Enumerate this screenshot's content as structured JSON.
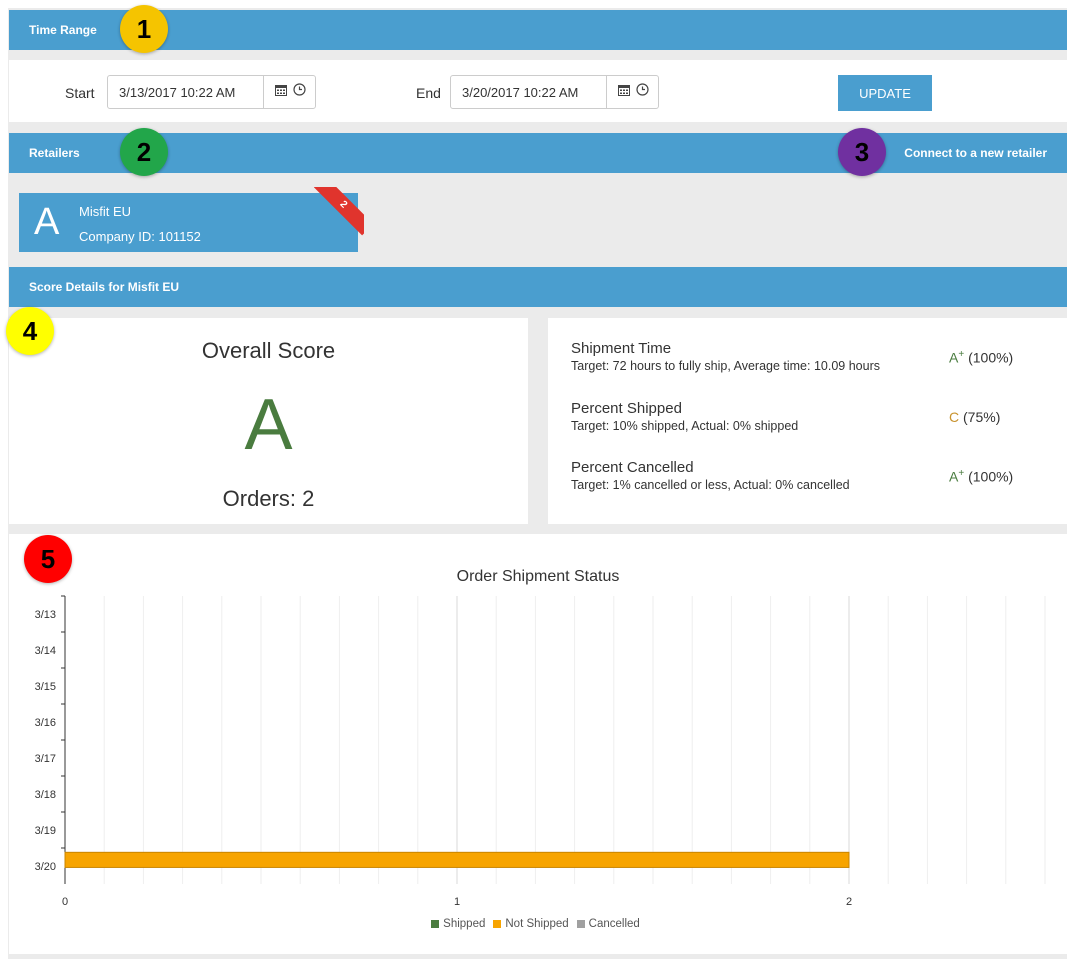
{
  "time_range": {
    "title": "Time Range",
    "start_label": "Start",
    "start_value": "3/13/2017 10:22 AM",
    "end_label": "End",
    "end_value": "3/20/2017 10:22 AM",
    "update_label": "UPDATE"
  },
  "retailers": {
    "title": "Retailers",
    "connect_label": "Connect to a new retailer",
    "card": {
      "letter": "A",
      "name": "Misfit EU",
      "company_id": "Company ID: 101152",
      "ribbon": "2"
    }
  },
  "score_details": {
    "title": "Score Details for Misfit EU",
    "overall_title": "Overall Score",
    "overall_grade": "A",
    "orders": "Orders: 2",
    "criteria": [
      {
        "name": "Shipment Time",
        "desc": "Target: 72 hours to fully ship, Average time: 10.09 hours",
        "grade": "A",
        "sup": "+",
        "pct": "(100%)",
        "color": "#4a7c3f"
      },
      {
        "name": "Percent Shipped",
        "desc": "Target: 10% shipped, Actual: 0% shipped",
        "grade": "C",
        "sup": "",
        "pct": "(75%)",
        "color": "#c8932f"
      },
      {
        "name": "Percent Cancelled",
        "desc": "Target: 1% cancelled or less, Actual: 0% cancelled",
        "grade": "A",
        "sup": "+",
        "pct": "(100%)",
        "color": "#4a7c3f"
      }
    ]
  },
  "callouts": [
    {
      "num": "1",
      "color": "#f5c400"
    },
    {
      "num": "2",
      "color": "#22a64a"
    },
    {
      "num": "3",
      "color": "#7030a0"
    },
    {
      "num": "4",
      "color": "#ffff00"
    },
    {
      "num": "5",
      "color": "#ff0000"
    }
  ],
  "chart_data": {
    "type": "bar",
    "orientation": "horizontal",
    "title": "Order Shipment Status",
    "categories": [
      "3/13",
      "3/14",
      "3/15",
      "3/16",
      "3/17",
      "3/18",
      "3/19",
      "3/20"
    ],
    "series": [
      {
        "name": "Shipped",
        "color": "#4a7c3f",
        "values": [
          0,
          0,
          0,
          0,
          0,
          0,
          0,
          0
        ]
      },
      {
        "name": "Not Shipped",
        "color": "#f7a400",
        "values": [
          0,
          0,
          0,
          0,
          0,
          0,
          0,
          2
        ]
      },
      {
        "name": "Cancelled",
        "color": "#a0a0a0",
        "values": [
          0,
          0,
          0,
          0,
          0,
          0,
          0,
          0
        ]
      }
    ],
    "xlim": [
      0,
      2.5
    ],
    "x_ticks": [
      "0",
      "1",
      "2"
    ],
    "stacked": true,
    "grid": true,
    "legend": "bottom-center"
  }
}
